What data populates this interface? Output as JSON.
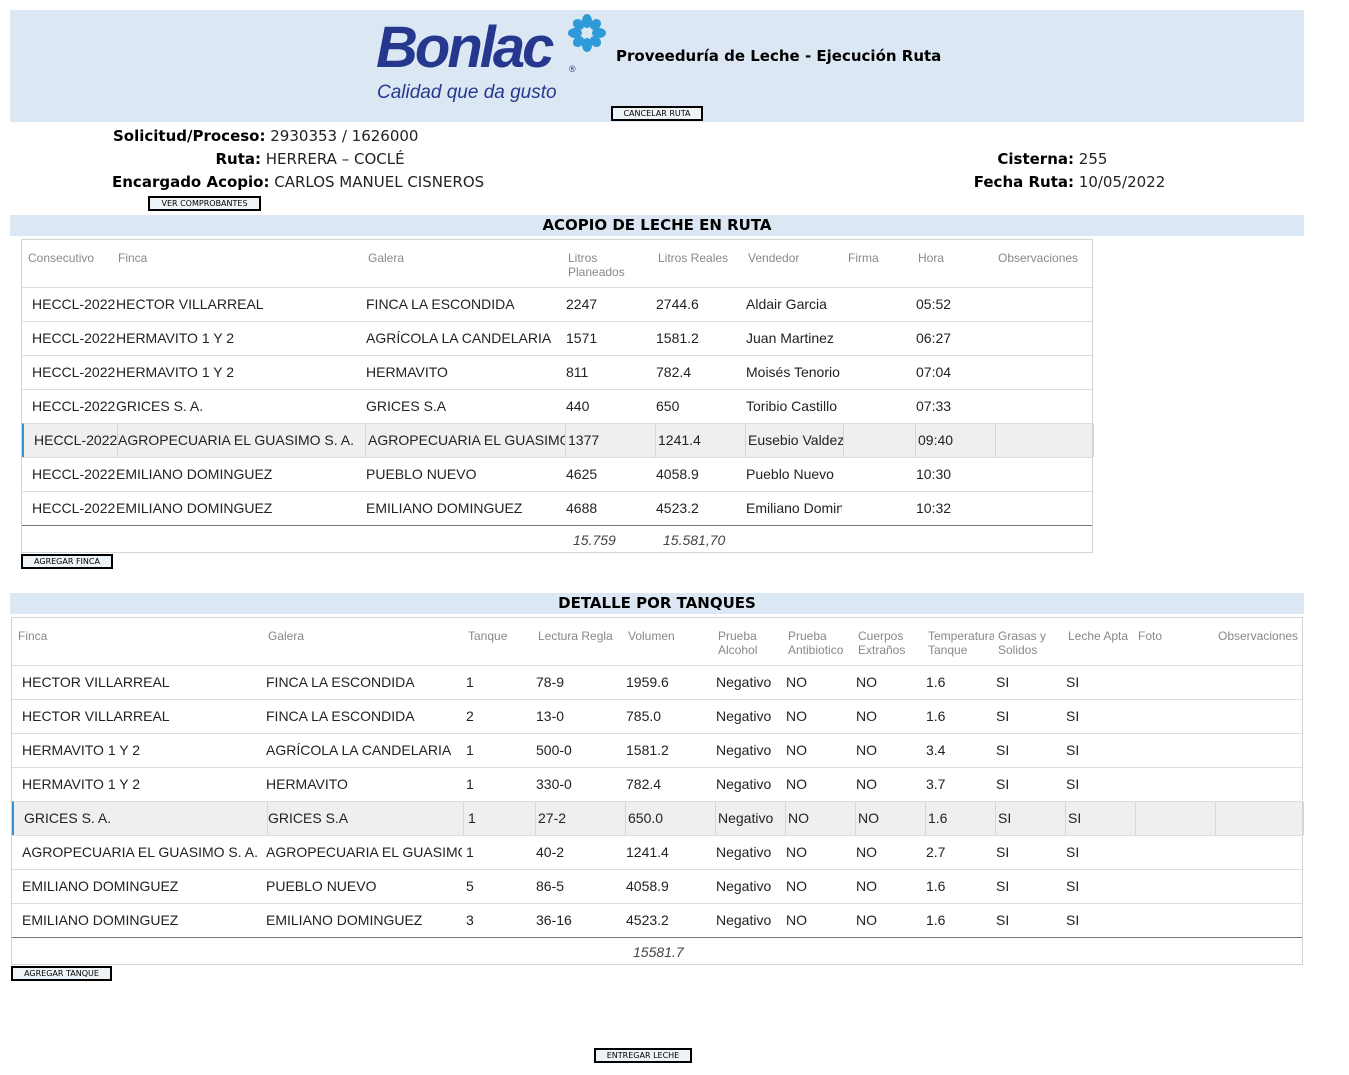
{
  "header": {
    "logo_text": "Bonlac",
    "logo_registered": "®",
    "logo_tagline": "Calidad que da gusto",
    "title": "Proveeduría de Leche - Ejecución Ruta",
    "cancel_button": "CANCELAR RUTA"
  },
  "info": {
    "solicitud_label": "Solicitud/Proceso:",
    "solicitud_value": "2930353 / 1626000",
    "ruta_label": "Ruta:",
    "ruta_value": "HERRERA – COCLÉ",
    "encargado_label": "Encargado Acopio:",
    "encargado_value": "CARLOS MANUEL CISNEROS",
    "cisterna_label": "Cisterna:",
    "cisterna_value": "255",
    "fecha_label": "Fecha Ruta:",
    "fecha_value": "10/05/2022",
    "comprobantes_button": "VER COMPROBANTES"
  },
  "acopio": {
    "title": "ACOPIO DE LECHE EN RUTA",
    "headers": [
      "Consecutivo",
      "Finca",
      "Galera",
      "Litros Planeados",
      "Litros Reales",
      "Vendedor",
      "Firma",
      "Hora",
      "Observaciones"
    ],
    "rows": [
      [
        "HECCL-2022",
        "HECTOR VILLARREAL",
        "FINCA LA ESCONDIDA",
        "2247",
        "2744.6",
        "Aldair Garcia",
        "",
        "05:52",
        ""
      ],
      [
        "HECCL-2022",
        "HERMAVITO 1 Y 2",
        "AGRÍCOLA LA CANDELARIA",
        "1571",
        "1581.2",
        "Juan Martinez",
        "",
        "06:27",
        ""
      ],
      [
        "HECCL-2022",
        "HERMAVITO 1 Y 2",
        "HERMAVITO",
        "811",
        "782.4",
        "Moisés Tenorio",
        "",
        "07:04",
        ""
      ],
      [
        "HECCL-2022",
        "GRICES S. A.",
        "GRICES S.A",
        "440",
        "650",
        "Toribio Castillo",
        "",
        "07:33",
        ""
      ],
      [
        "HECCL-2022",
        "AGROPECUARIA EL GUASIMO S. A.",
        "AGROPECUARIA EL GUASIMO",
        "1377",
        "1241.4",
        "Eusebio Valdez",
        "",
        "09:40",
        ""
      ],
      [
        "HECCL-2022",
        "EMILIANO DOMINGUEZ",
        "PUEBLO NUEVO",
        "4625",
        "4058.9",
        "Pueblo Nuevo",
        "",
        "10:30",
        ""
      ],
      [
        "HECCL-2022",
        "EMILIANO DOMINGUEZ",
        "EMILIANO DOMINGUEZ",
        "4688",
        "4523.2",
        "Emiliano Dominguez",
        "",
        "10:32",
        ""
      ]
    ],
    "selected_row": 4,
    "total_planeados": "15.759",
    "total_reales": "15.581,70",
    "add_button": "AGREGAR FINCA"
  },
  "tanques": {
    "title": "DETALLE POR TANQUES",
    "headers": [
      "Finca",
      "Galera",
      "Tanque",
      "Lectura Regla",
      "Volumen",
      "Prueba Alcohol",
      "Prueba Antibiotico",
      "Cuerpos Extraños",
      "Temperatura Tanque",
      "Grasas y Solidos",
      "Leche Apta",
      "Foto",
      "Observaciones"
    ],
    "rows": [
      [
        "HECTOR VILLARREAL",
        "FINCA LA ESCONDIDA",
        "1",
        "78-9",
        "1959.6",
        "Negativo",
        "NO",
        "NO",
        "1.6",
        "SI",
        "SI",
        "",
        ""
      ],
      [
        "HECTOR VILLARREAL",
        "FINCA LA ESCONDIDA",
        "2",
        "13-0",
        "785.0",
        "Negativo",
        "NO",
        "NO",
        "1.6",
        "SI",
        "SI",
        "",
        ""
      ],
      [
        "HERMAVITO 1 Y 2",
        "AGRÍCOLA LA CANDELARIA",
        "1",
        "500-0",
        "1581.2",
        "Negativo",
        "NO",
        "NO",
        "3.4",
        "SI",
        "SI",
        "",
        ""
      ],
      [
        "HERMAVITO 1 Y 2",
        "HERMAVITO",
        "1",
        "330-0",
        "782.4",
        "Negativo",
        "NO",
        "NO",
        "3.7",
        "SI",
        "SI",
        "",
        ""
      ],
      [
        "GRICES S. A.",
        "GRICES S.A",
        "1",
        "27-2",
        "650.0",
        "Negativo",
        "NO",
        "NO",
        "1.6",
        "SI",
        "SI",
        "",
        ""
      ],
      [
        "AGROPECUARIA EL GUASIMO S. A.",
        "AGROPECUARIA EL GUASIMO",
        "1",
        "40-2",
        "1241.4",
        "Negativo",
        "NO",
        "NO",
        "2.7",
        "SI",
        "SI",
        "",
        ""
      ],
      [
        "EMILIANO DOMINGUEZ",
        "PUEBLO NUEVO",
        "5",
        "86-5",
        "4058.9",
        "Negativo",
        "NO",
        "NO",
        "1.6",
        "SI",
        "SI",
        "",
        ""
      ],
      [
        "EMILIANO DOMINGUEZ",
        "EMILIANO DOMINGUEZ",
        "3",
        "36-16",
        "4523.2",
        "Negativo",
        "NO",
        "NO",
        "1.6",
        "SI",
        "SI",
        "",
        ""
      ]
    ],
    "selected_row": 4,
    "total_volumen": "15581.7",
    "add_button": "AGREGAR TANQUE"
  },
  "footer": {
    "deliver_button": "ENTREGAR LECHE"
  }
}
